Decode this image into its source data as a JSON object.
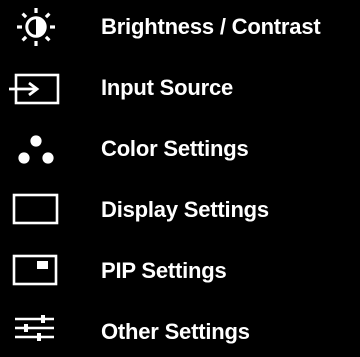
{
  "menu": {
    "items": [
      {
        "label": "Brightness / Contrast",
        "icon": "brightness-contrast-icon"
      },
      {
        "label": "Input Source",
        "icon": "input-source-icon"
      },
      {
        "label": "Color Settings",
        "icon": "color-settings-icon"
      },
      {
        "label": "Display Settings",
        "icon": "display-settings-icon"
      },
      {
        "label": "PIP Settings",
        "icon": "pip-settings-icon"
      },
      {
        "label": "Other Settings",
        "icon": "other-settings-icon"
      }
    ]
  },
  "colors": {
    "background": "#000000",
    "foreground": "#ffffff"
  }
}
